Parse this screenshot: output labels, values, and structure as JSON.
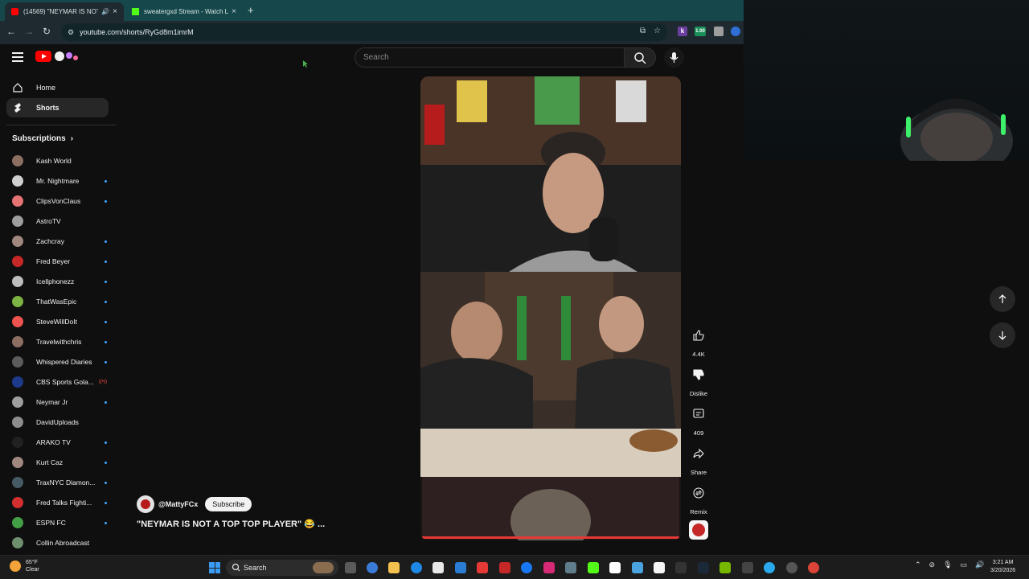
{
  "browser": {
    "tabs": [
      {
        "title": "(14569) \"NEYMAR IS NOT A",
        "active": true
      },
      {
        "title": "sweatergxd Stream - Watch Live",
        "active": false
      }
    ],
    "url": "youtube.com/shorts/RyGd8m1imrM",
    "extension_badge": "1.00"
  },
  "masthead": {
    "search_placeholder": "Search"
  },
  "sidebar": {
    "nav": [
      {
        "label": "Home",
        "icon": "home-icon"
      },
      {
        "label": "Shorts",
        "icon": "shorts-icon",
        "selected": true
      }
    ],
    "subscriptions_heading": "Subscriptions",
    "channels": [
      {
        "name": "Kash World",
        "dot": false,
        "color": "#8d6e63"
      },
      {
        "name": "Mr. Nightmare",
        "dot": true,
        "color": "#cfcfcf"
      },
      {
        "name": "ClipsVonClaus",
        "dot": true,
        "color": "#e57373"
      },
      {
        "name": "AstroTV",
        "dot": false,
        "color": "#9e9e9e"
      },
      {
        "name": "Zachcray",
        "dot": true,
        "color": "#a1887f"
      },
      {
        "name": "Fred Beyer",
        "dot": true,
        "color": "#c62828"
      },
      {
        "name": "Icellphonezz",
        "dot": true,
        "color": "#bdbdbd"
      },
      {
        "name": "ThatWasEpic",
        "dot": true,
        "color": "#7cb342"
      },
      {
        "name": "SteveWillDoIt",
        "dot": true,
        "color": "#ef5350"
      },
      {
        "name": "Travelwithchris",
        "dot": true,
        "color": "#8d6e63"
      },
      {
        "name": "Whispered Diaries",
        "dot": true,
        "color": "#5c5c5c"
      },
      {
        "name": "CBS Sports Gola...",
        "dot": false,
        "live": true,
        "color": "#1e3a8a"
      },
      {
        "name": "Neymar Jr",
        "dot": true,
        "color": "#9e9e9e"
      },
      {
        "name": "DavidUploads",
        "dot": false,
        "color": "#8d8d8d"
      },
      {
        "name": "ARAKO TV",
        "dot": true,
        "color": "#212121"
      },
      {
        "name": "Kurt Caz",
        "dot": true,
        "color": "#a1887f"
      },
      {
        "name": "TraxNYC Diamon...",
        "dot": true,
        "color": "#455a64"
      },
      {
        "name": "Fred Talks Fighti...",
        "dot": true,
        "color": "#d32f2f"
      },
      {
        "name": "ESPN FC",
        "dot": true,
        "color": "#43a047"
      },
      {
        "name": "Collin Abroadcast",
        "dot": false,
        "color": "#6d8f6d"
      }
    ]
  },
  "short": {
    "creator_handle": "@MattyFCx",
    "subscribe_label": "Subscribe",
    "title": "\"NEYMAR IS NOT A TOP TOP PLAYER\" 😂 ...",
    "actions": [
      {
        "icon": "like-icon",
        "label": "4.4K"
      },
      {
        "icon": "dislike-icon",
        "label": "Dislike"
      },
      {
        "icon": "comment-icon",
        "label": "409"
      },
      {
        "icon": "share-icon",
        "label": "Share"
      },
      {
        "icon": "remix-icon",
        "label": "Remix"
      }
    ]
  },
  "taskbar": {
    "weather_temp": "65°F",
    "weather_desc": "Clear",
    "search_label": "Search",
    "time": "3:21 AM",
    "date": "3/20/2026"
  },
  "colors": {
    "youtube_red": "#ff0000",
    "accent_blue": "#3ea6ff",
    "tabstrip": "#16484b"
  }
}
